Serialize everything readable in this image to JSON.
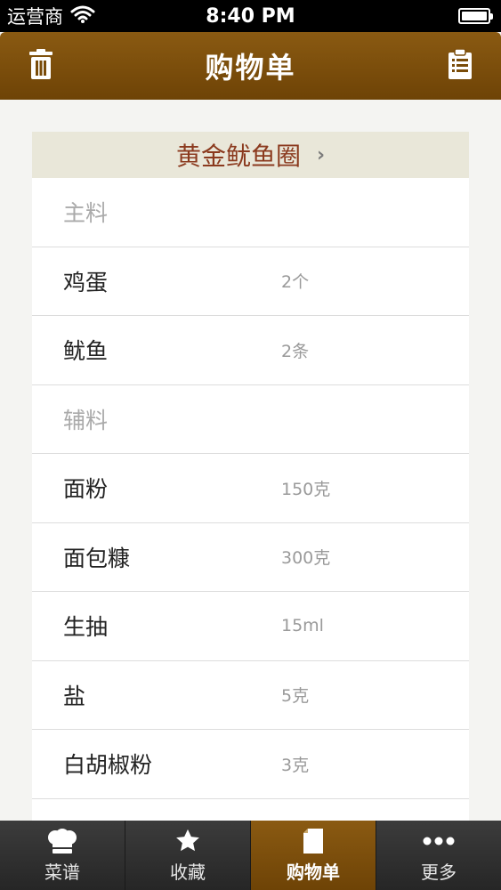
{
  "status": {
    "carrier": "运营商",
    "time": "8:40 PM",
    "battery_level": 1.0
  },
  "nav": {
    "title": "购物单",
    "left_icon": "trash-icon",
    "right_icon": "clipboard-icon"
  },
  "recipe": {
    "name": "黄金鱿鱼圈",
    "chevron": "›"
  },
  "rows": [
    {
      "type": "section",
      "label": "主料"
    },
    {
      "type": "item",
      "name": "鸡蛋",
      "amount": "2个"
    },
    {
      "type": "item",
      "name": "鱿鱼",
      "amount": "2条"
    },
    {
      "type": "section",
      "label": "辅料"
    },
    {
      "type": "item",
      "name": "面粉",
      "amount": "150克"
    },
    {
      "type": "item",
      "name": "面包糠",
      "amount": "300克"
    },
    {
      "type": "item",
      "name": "生抽",
      "amount": "15ml"
    },
    {
      "type": "item",
      "name": "盐",
      "amount": "5克"
    },
    {
      "type": "item",
      "name": "白胡椒粉",
      "amount": "3克"
    },
    {
      "type": "item",
      "name": "",
      "amount": ""
    }
  ],
  "tabs": [
    {
      "label": "菜谱",
      "icon": "chef-hat-icon",
      "active": false
    },
    {
      "label": "收藏",
      "icon": "star-icon",
      "active": false
    },
    {
      "label": "购物单",
      "icon": "document-icon",
      "active": true
    },
    {
      "label": "更多",
      "icon": "more-dots-icon",
      "active": false
    }
  ],
  "colors": {
    "brand": "#7a4c0a",
    "recipe_title": "#8b3a1e",
    "header_bg": "#e9e7d9"
  }
}
